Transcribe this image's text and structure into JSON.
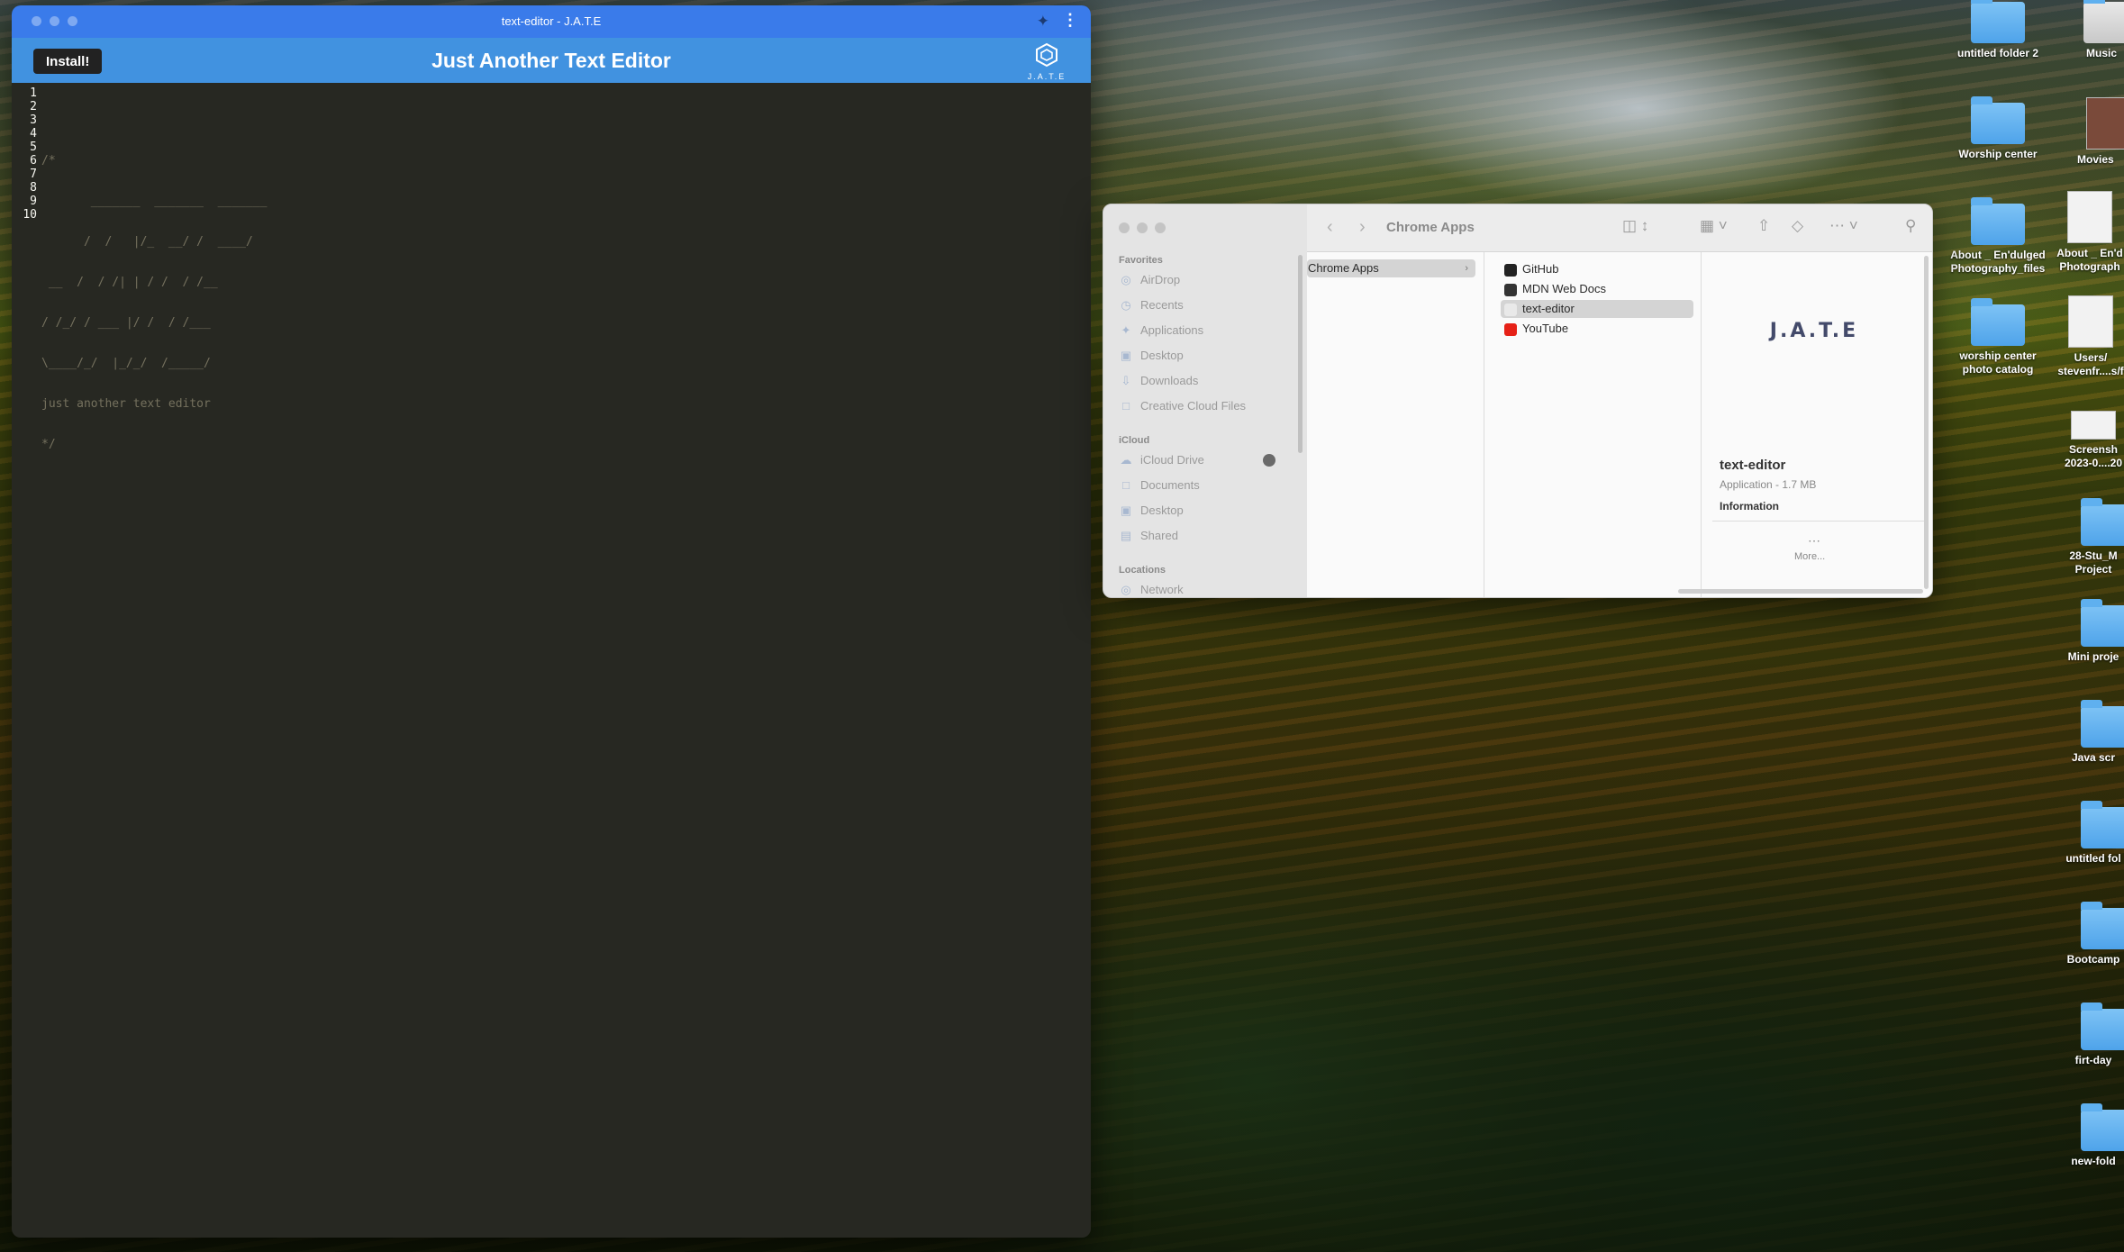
{
  "browser": {
    "window_title": "text-editor - J.A.T.E",
    "install_label": "Install!",
    "app_title": "Just Another Text Editor",
    "logo_text": "J.A.T.E",
    "line_numbers": [
      "1",
      "2",
      "3",
      "4",
      "5",
      "6",
      "7",
      "8",
      "9",
      "10"
    ],
    "code_lines": [
      "",
      "/*",
      "       _______  _______  _______",
      "      /  /   |/_  __/ /  ____/",
      " __  /  / /| | / /  / /__",
      "/ /_/ / ___ |/ /  / /___",
      "\\____/_/  |_/_/  /_____/",
      "just another text editor",
      "*/",
      ""
    ]
  },
  "finder": {
    "title": "Chrome Apps",
    "sidebar": {
      "favorites_heading": "Favorites",
      "favorites": [
        "AirDrop",
        "Recents",
        "Applications",
        "Desktop",
        "Downloads",
        "Creative Cloud Files"
      ],
      "icloud_heading": "iCloud",
      "icloud": [
        "iCloud Drive",
        "Documents",
        "Desktop",
        "Shared"
      ],
      "locations_heading": "Locations",
      "locations": [
        "Network"
      ]
    },
    "column1": [
      "Chrome Apps"
    ],
    "column2": [
      "GitHub",
      "MDN Web Docs",
      "text-editor",
      "YouTube"
    ],
    "selected_item": "text-editor",
    "preview": {
      "logo": "J.A.T.E",
      "name": "text-editor",
      "subtitle": "Application - 1.7 MB",
      "info_label": "Information",
      "more_label": "More..."
    }
  },
  "desktop": {
    "icons": [
      {
        "label": "untitled folder 2",
        "type": "folder"
      },
      {
        "label": "Music",
        "type": "folder"
      },
      {
        "label": "Worship center",
        "type": "folder"
      },
      {
        "label": "Movies",
        "type": "doc"
      },
      {
        "label": "About _ En'dulged Photography_files",
        "type": "folder"
      },
      {
        "label": "About _ En'd Photograph",
        "type": "doc"
      },
      {
        "label": "worship center photo catalog",
        "type": "folder"
      },
      {
        "label": "Users/ stevenfr....s/f",
        "type": "doc"
      },
      {
        "label": "Screensh 2023-0....20",
        "type": "doc"
      },
      {
        "label": "28-Stu_M Project",
        "type": "folder"
      },
      {
        "label": "Mini proje",
        "type": "folder"
      },
      {
        "label": "Java scr",
        "type": "folder"
      },
      {
        "label": "untitled fol",
        "type": "folder"
      },
      {
        "label": "Bootcamp",
        "type": "folder"
      },
      {
        "label": "firt-day",
        "type": "folder"
      },
      {
        "label": "new-fold",
        "type": "folder"
      }
    ]
  }
}
